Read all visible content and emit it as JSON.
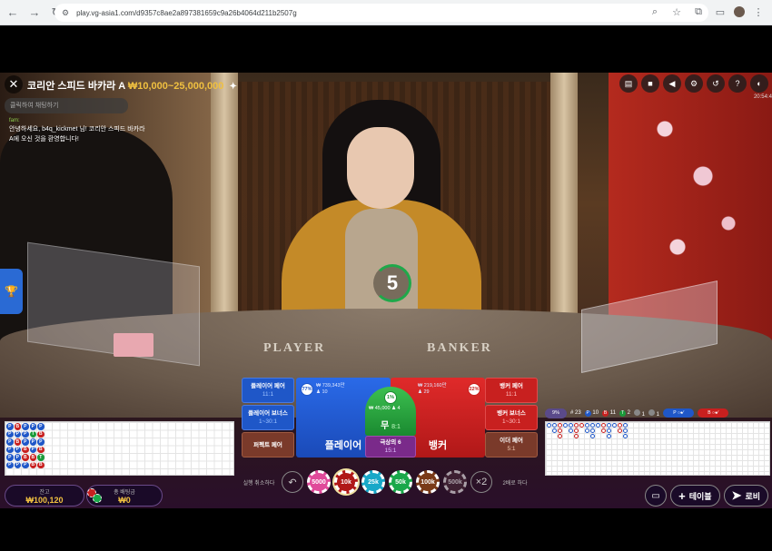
{
  "browser": {
    "url": "play.vg-asia1.com/d9357c8ae2a897381659c9a26b4064d211b2507g"
  },
  "game": {
    "table_name": "코리안 스피드 바카라 A",
    "table_limits": "₩10,000~25,000,000",
    "countdown": "5",
    "clock": "20:54:4",
    "chat": {
      "placeholder": "클릭하여 채팅하기",
      "user": "fam:",
      "message": "안녕하세요, b4q_kickmet 님! 코리안 스피드 바카라 A에 오신 것을 환영합니다!"
    },
    "table_felt": {
      "player": "PLAYER",
      "banker": "BANKER"
    },
    "bets": {
      "player_pair": {
        "label": "플레이어 페어",
        "odds": "11:1"
      },
      "player_bonus": {
        "label": "플레이어 보너스",
        "odds": "1~30:1"
      },
      "perfect_pair": {
        "label": "퍼펙트 페어"
      },
      "player": {
        "label": "플레이어",
        "pct": "77%",
        "amount": "₩ 739,343만",
        "players": "10"
      },
      "tie": {
        "label": "무",
        "odds": "8:1",
        "pct": "1%",
        "amount": "₩ 45,000",
        "players": "4"
      },
      "super6": {
        "label": "극상의 6",
        "odds": "15:1"
      },
      "banker": {
        "label": "뱅커",
        "pct": "22%",
        "amount": "₩ 219,160만",
        "players": "29"
      },
      "banker_pair": {
        "label": "뱅커 페어",
        "odds": "11:1"
      },
      "banker_bonus": {
        "label": "뱅커 보너스",
        "odds": "1~30:1"
      },
      "either_pair": {
        "label": "이더 페어",
        "odds": "5:1"
      }
    },
    "chips": {
      "undo_label": "실행 취소하다",
      "double_label": "2배로 하다",
      "values": [
        "5000",
        "10k",
        "25k",
        "50k",
        "100k",
        "500k"
      ],
      "double_symbol": "×2"
    },
    "stats": {
      "pct": "9%",
      "rounds": "23",
      "p_count": "10",
      "b_count": "11",
      "t_count": "2",
      "pp_count": "1",
      "bp_count": "1"
    },
    "balance": {
      "label": "잔고",
      "value": "₩100,120"
    },
    "total_bet": {
      "label": "총 배팅금",
      "value": "₩0"
    },
    "buttons": {
      "tables": "테이블",
      "lobby": "로비"
    },
    "bead_road": [
      [
        "P",
        "P",
        "P",
        "P",
        "P",
        "P"
      ],
      [
        "B",
        "P",
        "B",
        "P",
        "P",
        "P"
      ],
      [
        "P",
        "P",
        "P",
        "B",
        "B",
        "P"
      ],
      [
        "P",
        "T",
        "P",
        "P",
        "B",
        "B"
      ],
      [
        "P",
        "B",
        "P",
        "B",
        "T",
        "B"
      ]
    ]
  },
  "colors": {
    "player": "#1f57c8",
    "banker": "#c8201f",
    "tie": "#1a9a3a",
    "gold": "#f0c040"
  }
}
